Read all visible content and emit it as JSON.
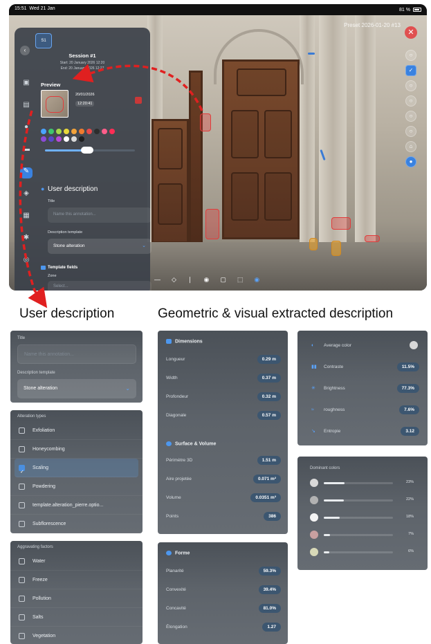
{
  "ipad": {
    "status": {
      "time": "15:51",
      "date": "Wed 21 Jan",
      "battery": "81 %"
    },
    "scene_title": "Preset 2026-01-20 #13",
    "close_glyph": "✕",
    "session": {
      "thumb_label": "S1",
      "title": "Session #1",
      "start": "Start: 20 January 2026 12:20",
      "end": "End: 20 January 2026 12:27"
    },
    "preview": {
      "heading": "Preview",
      "date": "20/01/2026",
      "time": "12:20:41"
    },
    "swatch_colors": [
      "#4aa3ff",
      "#3fc46e",
      "#a8d84a",
      "#e9d83a",
      "#f2a23a",
      "#f07b2e",
      "#e84a4a",
      "#2d2d2d",
      "#ff5e8a",
      "#ff2d55",
      "#8c4bd6",
      "#5a48c8",
      "#b84ad6",
      "#ffffff",
      "#d9d9d9",
      "#1f1f1f"
    ],
    "slider_fill": 0.47,
    "ud_heading": "User description",
    "title_label": "Title",
    "title_placeholder": "Name this annotation...",
    "template_label": "Description template",
    "template_value": "Stone alteration",
    "template_fields": "Template fields",
    "zone_label": "Zone",
    "zone_placeholder": "Select...",
    "rail_icons": [
      "photo-icon",
      "list-icon",
      "mic-icon",
      "ruler-icon",
      "draw-icon",
      "layers-icon",
      "grid-icon",
      "figure-icon",
      "link-icon"
    ],
    "rail_glyphs": [
      "▣",
      "▤",
      "●",
      "▬",
      "✎",
      "◈",
      "▦",
      "✱",
      "◎"
    ],
    "right_tool_glyphs": [
      "○",
      "✓",
      "○",
      "○",
      "○",
      "○",
      "⌂",
      "●"
    ],
    "bottom_tool_glyphs": [
      "—",
      "◇",
      "❘",
      "◉",
      "▢",
      "⬚",
      "◉"
    ]
  },
  "headings": {
    "user": "User description",
    "geo": "Geometric & visual extracted description"
  },
  "user_panel": {
    "title_label": "Title",
    "title_placeholder": "Name this annotation...",
    "template_label": "Description template",
    "template_value": "Stone alteration"
  },
  "alteration": {
    "heading": "Alteration types",
    "items": [
      "Exfoliation",
      "Honeycombing",
      "Scaling",
      "Powdering",
      "template.alteration_pierre.optio...",
      "Subflorescence"
    ],
    "checked_index": 2
  },
  "aggravating": {
    "heading": "Aggravating factors",
    "items": [
      "Water",
      "Freeze",
      "Pollution",
      "Salts",
      "Vegetation"
    ]
  },
  "dimensions": {
    "heading": "Dimensions",
    "rows": [
      {
        "label": "Longueur",
        "value": "0.29 m"
      },
      {
        "label": "Width",
        "value": "0.37 m"
      },
      {
        "label": "Profondeur",
        "value": "0.32 m"
      },
      {
        "label": "Diagonale",
        "value": "0.57 m"
      }
    ]
  },
  "surface": {
    "heading": "Surface & Volume",
    "rows": [
      {
        "label": "Périmètre 3D",
        "value": "1.51 m"
      },
      {
        "label": "Aire projetée",
        "value": "0.071 m²"
      },
      {
        "label": "Volume",
        "value": "0.0351 m³"
      },
      {
        "label": "Points",
        "value": "386"
      }
    ]
  },
  "forme": {
    "heading": "Forme",
    "rows": [
      {
        "label": "Planarité",
        "value": "59.3%"
      },
      {
        "label": "Convexité",
        "value": "39.4%"
      },
      {
        "label": "Concavité",
        "value": "81.0%"
      },
      {
        "label": "Élongation",
        "value": "1.27"
      }
    ]
  },
  "visual": {
    "avg_label": "Average color",
    "avg_color": "#d8d8d8",
    "rows": [
      {
        "icon": "contrast-icon",
        "glyph": "▮▮",
        "label": "Contraste",
        "value": "11.5%"
      },
      {
        "icon": "brightness-icon",
        "glyph": "✳",
        "label": "Brightness",
        "value": "77.3%"
      },
      {
        "icon": "roughness-icon",
        "glyph": "≈",
        "label": "roughness",
        "value": "7.6%"
      },
      {
        "icon": "entropy-icon",
        "glyph": "↘",
        "label": "Entropie",
        "value": "3.12"
      }
    ]
  },
  "dominant": {
    "heading": "Dominant colors",
    "rows": [
      {
        "color": "#d9d9d9",
        "pct": "23%",
        "fraction": 0.23
      },
      {
        "color": "#b2b2b2",
        "pct": "22%",
        "fraction": 0.22
      },
      {
        "color": "#f4f4f4",
        "pct": "18%",
        "fraction": 0.18
      },
      {
        "color": "#c9a0a0",
        "pct": "7%",
        "fraction": 0.07
      },
      {
        "color": "#d8d9b8",
        "pct": "6%",
        "fraction": 0.06
      }
    ]
  }
}
